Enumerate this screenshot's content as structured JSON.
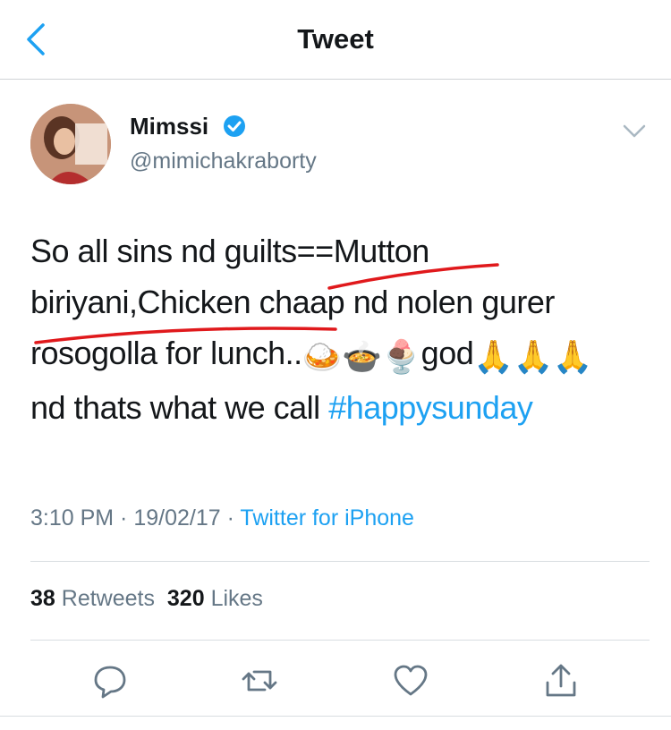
{
  "header": {
    "title": "Tweet",
    "back_icon": "chevron-left-icon"
  },
  "user": {
    "name": "Mimssi",
    "handle": "@mimichakraborty",
    "verified": true
  },
  "tweet": {
    "line1": "So all sins nd guilts==Mutton",
    "line2": "biriyani,Chicken chaap nd nolen gurer",
    "line3_text": "rosogolla for lunch..",
    "line3_emojis": "🍛🍲🍨",
    "line3_after": "god",
    "line3_hands": "🙏🙏🙏",
    "line4_text": "nd thats what we call ",
    "hashtag": "#happysunday"
  },
  "meta": {
    "time": "3:10 PM",
    "sep": " · ",
    "date": "19/02/17",
    "source": "Twitter for iPhone"
  },
  "stats": {
    "retweets": "38",
    "retweets_label": "Retweets",
    "likes": "320",
    "likes_label": "Likes"
  },
  "colors": {
    "accent": "#1da1f2",
    "muted": "#657786",
    "annotation": "#e0191c"
  }
}
